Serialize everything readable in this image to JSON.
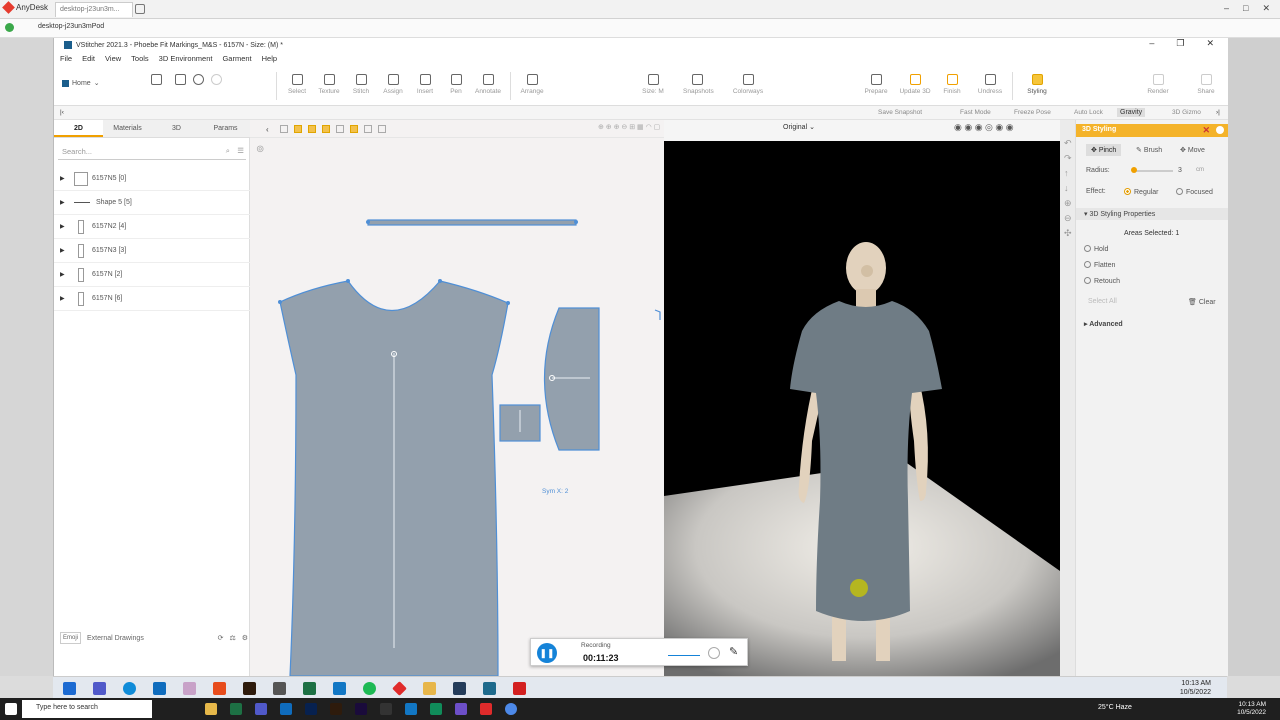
{
  "anydesk": {
    "app_name": "AnyDesk",
    "tab_label": "desktop-j23un3m...",
    "address": "desktop-j23un3mPod"
  },
  "window": {
    "title": "VStitcher 2021.3 - Phoebe Fit Markings_M&S - 6157N - Size: (M) *"
  },
  "menu": [
    "File",
    "Edit",
    "View",
    "Tools",
    "3D Environment",
    "Garment",
    "Help"
  ],
  "toolbar": {
    "home": "Home",
    "tools": [
      "Select",
      "Texture",
      "Stitch",
      "Assign",
      "Insert",
      "Pen",
      "Annotate",
      "Arrange"
    ],
    "right_tools": [
      "Size: M",
      "Snapshots",
      "Colorways"
    ],
    "actions": [
      "Prepare",
      "Update 3D",
      "Finish",
      "Undress",
      "Styling",
      "Render",
      "Share"
    ]
  },
  "subbar": {
    "items": [
      "Save Snapshot",
      "Fast Mode",
      "Freeze Pose",
      "Auto Lock",
      "Gravity",
      "3D Gizmo"
    ],
    "view_mode": "Original"
  },
  "left_panel": {
    "tabs": [
      "2D",
      "Materials",
      "3D",
      "Params"
    ],
    "active_tab": "2D",
    "search_placeholder": "Search...",
    "rows": [
      {
        "name": "6157N5",
        "count": "[0]"
      },
      {
        "name": "Shape 5",
        "count": "[5]"
      },
      {
        "name": "6157N2",
        "count": "[4]"
      },
      {
        "name": "6157N3",
        "count": "[3]"
      },
      {
        "name": "6157N",
        "count": "[2]"
      },
      {
        "name": "6157N",
        "count": "[6]"
      }
    ],
    "footer_badge": "Emoji",
    "footer_label": "External Drawings"
  },
  "two_d": {
    "sym_label": "Sym X: 2"
  },
  "styling_panel": {
    "title": "3D Styling",
    "modes": [
      "Pinch",
      "Brush",
      "Move"
    ],
    "radius_label": "Radius:",
    "radius_value": "3",
    "radius_unit": "cm",
    "effect_label": "Effect:",
    "effects": [
      "Regular",
      "Focused"
    ],
    "section_title": "3D Styling Properties",
    "areas_selected": "Areas Selected: 1",
    "options": [
      "Hold",
      "Flatten",
      "Retouch"
    ],
    "select_all": "Select All",
    "clear": "Clear",
    "advanced": "Advanced"
  },
  "recorder": {
    "status": "Recording",
    "time": "00:11:23"
  },
  "remote_clock": {
    "time": "10:13 AM",
    "date": "10/5/2022"
  },
  "local_taskbar": {
    "search_placeholder": "Type here to search",
    "weather": "25°C Haze",
    "time": "10:13 AM",
    "date": "10/5/2022"
  },
  "colors": {
    "accent": "#f4b32a",
    "pattern_fill": "#93a0ad",
    "pattern_stroke": "#4f8fd6",
    "garment": "#6f7c85",
    "avatar": "#e2d2bd"
  }
}
